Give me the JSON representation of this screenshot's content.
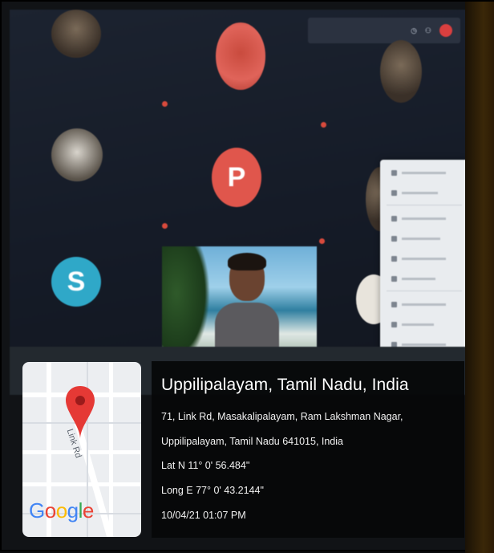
{
  "overlay": {
    "place": "Uppilipalayam, Tamil Nadu, India",
    "address_line1": "71, Link Rd, Masakalipalayam, Ram Lakshman Nagar,",
    "address_line2": "Uppilipalayam, Tamil Nadu 641015, India",
    "lat": "Lat N 11° 0' 56.484\"",
    "long": "Long E 77° 0' 43.2144\"",
    "datetime": "10/04/21 01:07 PM"
  },
  "map": {
    "road_label": "Link Rd",
    "logo": [
      "G",
      "o",
      "o",
      "g",
      "l",
      "e"
    ],
    "logo_colors": [
      "#4285F4",
      "#EA4335",
      "#FBBC05",
      "#4285F4",
      "#34A853",
      "#EA4335"
    ],
    "pin_color": "#E53935"
  },
  "meeting": {
    "tile_letters": [
      "P",
      "S"
    ],
    "tile_colors": [
      "#E0564C",
      "#2FA8C8"
    ]
  },
  "icons": [
    "location-pin-icon"
  ]
}
